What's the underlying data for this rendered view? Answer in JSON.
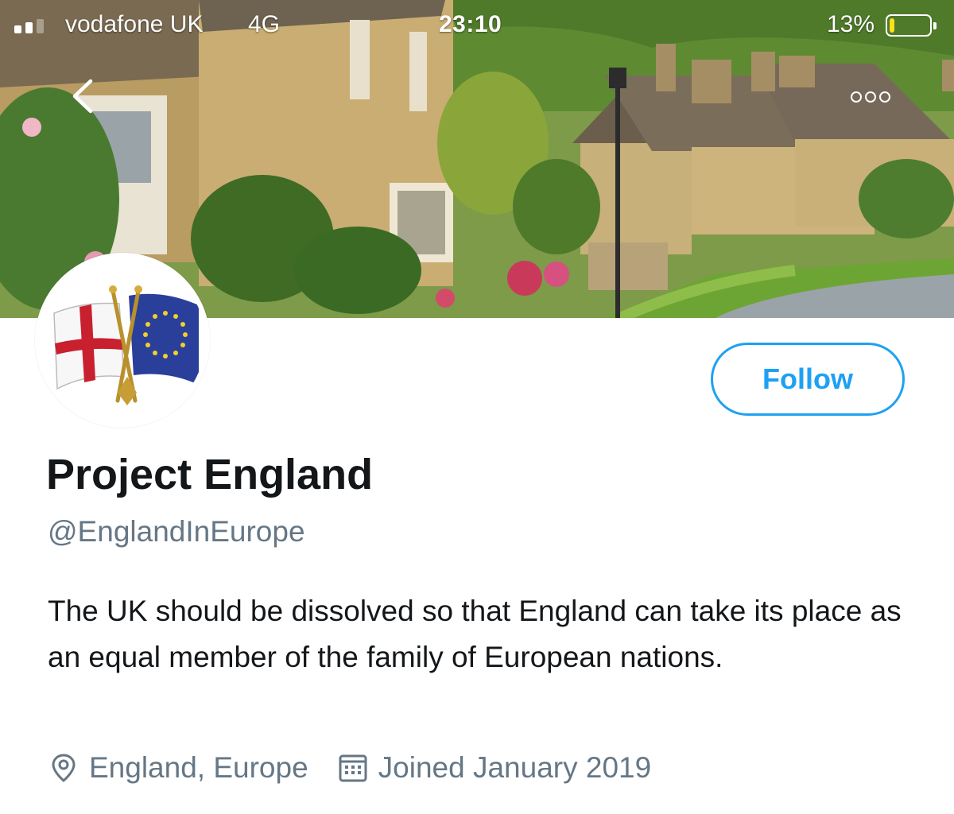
{
  "status_bar": {
    "carrier": "vodafone UK",
    "network": "4G",
    "time": "23:10",
    "battery_percent": "13%",
    "battery_level": 0.13,
    "battery_color": "#ffe01b"
  },
  "nav": {
    "back_icon": "chevron-left-icon",
    "more_icon": "more-horizontal-icon"
  },
  "banner": {
    "description_icon": "cotswold-village-photo"
  },
  "avatar": {
    "icon": "england-eu-crossed-flags-icon"
  },
  "profile": {
    "display_name": "Project England",
    "handle": "@EnglandInEurope",
    "bio": "The UK should be dissolved so that England can take its place as an equal member of the family of European nations.",
    "location": "England, Europe",
    "joined": "Joined January 2019"
  },
  "actions": {
    "follow_label": "Follow"
  },
  "colors": {
    "accent": "#1da1f2",
    "secondary_text": "#657786",
    "primary_text": "#14171a"
  }
}
